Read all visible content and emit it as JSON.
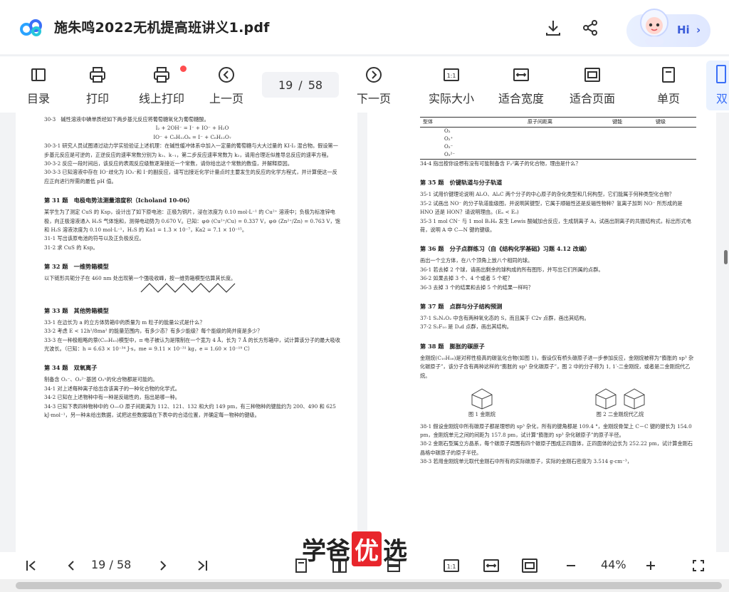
{
  "window": {
    "title": "施朱鸣2022无机提高班讲义1.pdf"
  },
  "header": {
    "greeting": "Hi"
  },
  "toolbar": {
    "toc": "目录",
    "print": "打印",
    "online_print": "线上打印",
    "prev": "上一页",
    "current_page": "19",
    "separator": "/",
    "total_pages": "58",
    "next": "下一页",
    "actual_size": "实际大小",
    "fit_width": "适合宽度",
    "fit_page": "适合页面",
    "single_page": "单页",
    "double_page": "双"
  },
  "left_page": {
    "blocks": [
      {
        "type": "p",
        "text": "30-3　碱性溶液中碘单质经如下两步基元反应将葡萄糖氧化为葡萄糖酸。"
      },
      {
        "type": "c",
        "text": "I₂ + 2OH⁻ = I⁻ + IO⁻ + H₂O"
      },
      {
        "type": "c",
        "text": "IO⁻ + C₆H₁₂O₆ = I⁻ + C₆H₁₂O₇"
      },
      {
        "type": "p",
        "text": "30-3-1 研究人员试图通过动力学实验验证上述机理：在碱性缓冲体系中加入一定量的葡萄糖与大大过量的 KI-I₂ 混合物。假设第一步基元反应是可逆的，正逆反应的速率常数分别为 k₁、k₋₁，第二步反应速率常数为 k₂，请用合理近似推导总反应的速率方程。"
      },
      {
        "type": "p",
        "text": "30-3-2 反应一段时间后，该反应的表观反应级数逐渐接近一个常数，请你给出这个常数的数值，并解释原因。"
      },
      {
        "type": "p",
        "text": "30-3-3 已知溶液中存在 IO⁻歧化为 IO₃⁻和 I⁻的副反应，请写出接近化学计量点时主要发生的反应的化学方程式，并计算使这一反应正向进行所需的最低 pH 值。"
      },
      {
        "type": "h",
        "text": "第 31 题　电极电势法测量溶度积（Icholand 10-06）"
      },
      {
        "type": "p",
        "text": "某学生为了测定 CuS 的 Ksp，设计出了如下原电池：正极为铜片，浸在浓度为 0.10 mol·L⁻¹ 的 Cu²⁺ 溶液中；负极为标准锌电极，向正极溶液通入 H₂S 气体饱和，测得电动势为 0.670 V。已知：φ⊖ (Cu²⁺/Cu) = 0.337 V，φ⊖ (Zn²⁺/Zn) = 0.763 V，饱和 H₂S 溶液浓度为 0.10 mol·L⁻¹，H₂S 的 Ka1 = 1.3 × 10⁻⁷，Ka2 = 7.1 × 10⁻¹⁵。"
      },
      {
        "type": "p",
        "text": "31-1 写出该原电池的符号以及正负极反应。"
      },
      {
        "type": "p",
        "text": "31-2 求 CuS 的 Ksp。"
      },
      {
        "type": "h",
        "text": "第 32 题　一维势箱模型"
      },
      {
        "type": "p",
        "text": "以下链形共轭分子在 460 nm 处出现第一个强吸收峰，按一维势箱模型估算其长度。"
      },
      {
        "type": "h",
        "text": "第 33 题　其他势箱模型"
      },
      {
        "type": "p",
        "text": "33-1 在边长为 a 的立方体势箱中的质量为 m 粒子的能量公式是什么？"
      },
      {
        "type": "p",
        "text": "33-2 考虑 E < 12h²/8ma² 的能量范围内，有多少态？有多少能级？每个能级的简并度是多少？"
      },
      {
        "type": "p",
        "text": "33-3 在一种极粗略的萘(C₁₀H₁₀)模型中，π 电子被认为是限制在一个宽为 4 Å，长为 7 Å 的长方形箱中，试计算该分子的最大吸收光波长。（已知：h = 6.63 × 10⁻³⁴ J·s，me = 9.11 × 10⁻³¹ kg，e = 1.60 × 10⁻¹⁹ C）"
      },
      {
        "type": "h",
        "text": "第 34 题　双氧离子"
      },
      {
        "type": "p",
        "text": "制备含 O₂⁻、O₂²⁻基团 O₂ⁿ的化合物都是可能的。"
      },
      {
        "type": "p",
        "text": "34-1 对上述每种离子给出含该离子的一种化合物的化学式。"
      },
      {
        "type": "p",
        "text": "34-2 已知在上述物种中有一种是反磁性的，指出是哪一种。"
      },
      {
        "type": "p",
        "text": "34-3 已知下表四种物种中的 O—O 原子间距离为 112、121、132 和大约 149 pm，有三种物种的键能约为 200、490 和 625 kJ·mol⁻¹，另一种未给出数据，试把这些数据填在下表中的合适位置，并确定每一物种的键级。"
      }
    ]
  },
  "right_page": {
    "table": {
      "headers": [
        "型体",
        "原子间距离",
        "键能",
        "键级"
      ],
      "rows": [
        "O₂",
        "O₂⁺",
        "O₂⁻",
        "O₂²⁻"
      ]
    },
    "blocks": [
      {
        "type": "p",
        "text": "34-4 指出按你设想有没有可能制备含 F₂²离子的化合物，理由是什么？"
      },
      {
        "type": "h",
        "text": "第 35 题　价键轨道与分子轨道"
      },
      {
        "type": "p",
        "text": "35-1 试用价键理论说明 Al₂O、Al₄C 两个分子的中心原子的杂化类型和几何构型，它们能属于何种类型化合物？"
      },
      {
        "type": "p",
        "text": "35-2 试画出 NO⁻ 的分子轨道能级图，并说明其键型，它属于顺磁性还是反磁性物种？氢离子加到 NO⁻ 所形成的是 HNO 还是 HON？请说明理由。(Eₙ < Eₒ)"
      },
      {
        "type": "p",
        "text": "35-3 1 mol CN⁻ 与 1 mol B₂H₆ 发生 Lewis 酸碱加合反应，生成阴离子 A，试画出阴离子的共振结构式，标出形式电荷，说明 A 中 C—N 键的键级。"
      },
      {
        "type": "h",
        "text": "第 36 题　分子点群练习（自《结构化学基础》习题 4.12 改编）"
      },
      {
        "type": "p",
        "text": "画出一个立方体，在八个顶角上放八个相同的球。"
      },
      {
        "type": "p",
        "text": "36-1 若去掉 2 个球，请画出剩余的球构成的所有图形，并写出它们所属的点群。"
      },
      {
        "type": "p",
        "text": "36-2 如果去掉 3 个、4 个或者 5 个呢？"
      },
      {
        "type": "p",
        "text": "36-3 去掉 3 个的结果和去掉 5 个的结果一样吗？"
      },
      {
        "type": "h",
        "text": "第 37 题　点群与分子结构预测"
      },
      {
        "type": "p",
        "text": "37-1 S₂N₂O₂ 中含有两种氧化态的 S，而且属于 C2v 点群，画出其结构。"
      },
      {
        "type": "p",
        "text": "37-2 S₂F₁₀ 是 D₄d 点群，画出其结构。"
      },
      {
        "type": "h",
        "text": "第 38 题　膨胀的碳原子"
      },
      {
        "type": "p",
        "text": "金刚烷(C₁₀H₁₆)是对称性极高的碳氢化合物(如图 1)，假设仅有桥头碳原子进一步参加反应，金刚烷被称为“膨胀的 sp³ 杂化碳原子”，该分子含有两种这样的“膨胀的 sp³ 杂化碳原子”，图 2 中的分子称为 1, 1′-二金刚烷，或者是二金刚烷代乙烷。"
      },
      {
        "type": "fig",
        "captions": [
          "图 1  金刚烷",
          "图 2  二金刚烷代乙烷"
        ]
      },
      {
        "type": "p",
        "text": "38-1 假设金刚烷中所有碳原子都是理想的 sp³ 杂化，所有的键角都是 109.4 °，金刚烷骨架上 C－C 键的键长为 154.0 pm，金刚烷单元之间的间距为 157.8 pm，试计算“膨胀的 sp³ 杂化碳原子”的原子半径。"
      },
      {
        "type": "p",
        "text": "38-2 金刚石型属立方晶系，每个碳原子周围有四个碳原子围成正四面体，正四面体的边长为 252.22 pm，试计算金刚石晶格中碳原子的原子半径。"
      },
      {
        "type": "p",
        "text": "38-3 若用金刚烷单元取代金刚石中所有的实际碳原子，实际的金刚石密度为 3.514 g·cm⁻³，"
      }
    ]
  },
  "bottom": {
    "current_page": "19",
    "separator": "/",
    "total_pages": "58",
    "zoom": "44%"
  },
  "watermark": {
    "part1": "学爸",
    "badge": "优",
    "part2": "选"
  },
  "colors": {
    "accent": "#3a6ff7",
    "badge_dot": "#ff4d4f",
    "watermark_badge": "#e8262c"
  }
}
